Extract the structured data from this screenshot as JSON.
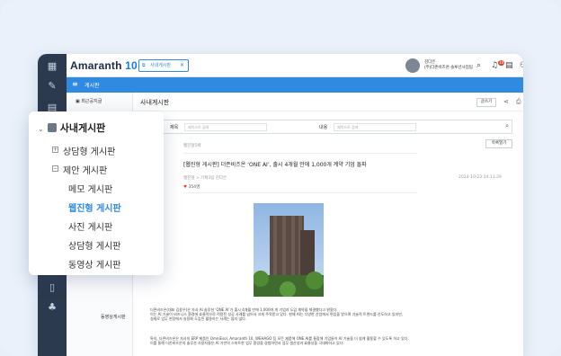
{
  "app": {
    "logo_text": "Amaranth",
    "logo_num": "10",
    "open_tab": "사내게시판",
    "user": {
      "name": "김다은",
      "dept": "(주)더존비즈온 솔루션사업팀"
    },
    "notification_count": "10"
  },
  "menu_bar": {
    "title": "게시판"
  },
  "sidebar": {
    "recent_label": "최근공지글",
    "video_label": "동영상게시판"
  },
  "main": {
    "title": "사내게시판",
    "write_button": "글쓰기",
    "search": {
      "title_label": "제목",
      "title_placeholder": "제목으로 검색",
      "content_label": "내용",
      "content_placeholder": "제목으로 검색"
    },
    "list_button": "목록열기",
    "breadcrumb": "웹진형5페",
    "article": {
      "title": "[웹진형 게시판] 더존비즈온 ‘ONE AI’, 출시 4개월 만에 1,000개 계약 기업 돌파",
      "meta": "웹진형 > 기획3팀 김다은",
      "date": "2024-10-23 14:11:29",
      "likes": "354명",
      "body_lines_1": [
        "더존비즈온(대표 김용우)은 자사 AI 솔루션 ‘ONE AI’가 출시 4개월 만에 1,000여 개 기업과 도입 계약을 체결했다고 밝혔다.",
        "이는 AI 기술이 비즈니스 환경에 효율적으로 적용된 성공 사례를 넘어서 크게 주목받고 있다. 현재 AI는 다양한 산업에서 편입을 받으며 기술적 트렌드를 선도하고 있지만,",
        "실제로 업무 현장에서 실용화 도입된 활용하는 사례는 많지 않다."
      ],
      "body_lines_2": [
        "특히, 더존비즈온은 자사의 ERP 제품인 OmniEsol, Amaranth 10, WEHAGO 등 모든 제품에 ONE AI를 통합해 기업들이 AI 기술을 더 쉽게 활용할 수 있도록 하고 있다.",
        "이를 통해 더존비즈온의 솔루션 사용자들은 AI 기반의 스마트한 업무 환경을 경험하면서 업무 생산성과 효율성을 극대화하고 있다."
      ]
    }
  },
  "popup": {
    "header": "사내게시판",
    "items": [
      {
        "label": "상담형 게시판",
        "kind": "plus"
      },
      {
        "label": "제안 게시판",
        "kind": "minus"
      },
      {
        "label": "메모 게시판",
        "kind": "leaf"
      },
      {
        "label": "웹진형 게시판",
        "kind": "leaf-active"
      },
      {
        "label": "사진 게시판",
        "kind": "leaf"
      },
      {
        "label": "상담형 게시판",
        "kind": "leaf"
      },
      {
        "label": "동영상 게시판",
        "kind": "leaf"
      }
    ]
  },
  "colors": {
    "accent": "#2f8ae0",
    "sidebar": "#2c3a4f"
  }
}
